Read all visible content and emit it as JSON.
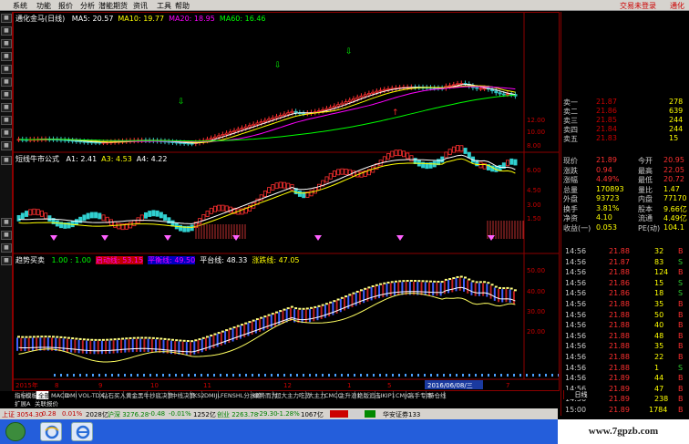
{
  "menu": {
    "items": [
      "系统",
      "功能",
      "报价",
      "分析",
      "潜能期货",
      "资讯",
      "工具",
      "帮助"
    ],
    "right": [
      "交易未登录",
      "通化"
    ]
  },
  "left_icons": [
    "grid-icon",
    "chart-icon",
    "list-icon",
    "bar-icon",
    "trend-icon",
    "kline-icon",
    "candle-icon",
    "zoom-icon",
    "tick-icon",
    "flag-icon",
    "square-icon",
    "globe-icon",
    "rsi-icon",
    "candle2-icon",
    "fx-icon",
    "a-icon"
  ],
  "panel1": {
    "name": "通化金马(日线)",
    "ma": [
      {
        "label": "MA5: 20.57",
        "color": "#ffffff"
      },
      {
        "label": "MA10: 19.77",
        "color": "#ffff00"
      },
      {
        "label": "MA20: 18.95",
        "color": "#ff00ff"
      },
      {
        "label": "MA60: 16.46",
        "color": "#00ff00"
      }
    ],
    "axis": [
      "12.00",
      "10.00",
      "8.00"
    ]
  },
  "panel2": {
    "name": "短线牛市公式",
    "values": [
      {
        "label": "A1: 2.41",
        "color": "#ffffff"
      },
      {
        "label": "A3: 4.53",
        "color": "#ffff00"
      },
      {
        "label": "A4: 4.22",
        "color": "#ffffff"
      }
    ],
    "axis": [
      "6.00",
      "4.50",
      "3.00",
      "1.50"
    ]
  },
  "panel3": {
    "name": "趋势买卖",
    "values": [
      {
        "label": "1.00 : 1.00",
        "color": "#00ff00"
      },
      {
        "label": "启动线: 53.15",
        "color": "#ff00ff",
        "bg": "#c00000"
      },
      {
        "label": "平衡线: 49.50",
        "color": "#ff00ff",
        "bg": "#0000c0"
      },
      {
        "label": "平台线: 48.33",
        "color": "#ffffff"
      },
      {
        "label": "涨跌线: 47.05",
        "color": "#ffff00"
      }
    ],
    "axis": [
      "50.00",
      "40.00",
      "30.00",
      "20.00"
    ]
  },
  "dates": [
    "2015年",
    "8",
    "9",
    "10",
    "11",
    "12",
    "1",
    "5",
    "2016/06/08/三",
    "7"
  ],
  "tabs": {
    "row1": [
      "指标",
      "模板",
      "全部",
      "MACD",
      "DMI",
      "VOL-TDX",
      "钻石买入",
      "黄金黑牛",
      "抄底决策",
      "中线决策",
      "KS2",
      "DMIJL",
      "FENSHL分水岭",
      "顺势而为",
      "超大主力吃货",
      "大主力",
      "CMCC",
      "主升浪1",
      "绝版追击",
      "LIKIP1",
      "CMJC",
      "高手专用",
      "持仓线"
    ],
    "row2": [
      "扩展A",
      "关联报价"
    ],
    "right_label": "日线"
  },
  "quote": {
    "orderbook": [
      {
        "label": "卖一",
        "price": "21.87",
        "vol": "278"
      },
      {
        "label": "卖二",
        "price": "21.86",
        "vol": "639"
      },
      {
        "label": "卖三",
        "price": "21.85",
        "vol": "244"
      },
      {
        "label": "卖四",
        "price": "21.84",
        "vol": "244"
      },
      {
        "label": "卖五",
        "price": "21.83",
        "vol": "15"
      }
    ],
    "axis_right": [
      "12.00",
      "10.00",
      "8.00"
    ],
    "stats": [
      {
        "l1": "现价",
        "v1": "21.89",
        "l2": "今开",
        "v2": "20.95"
      },
      {
        "l1": "涨跌",
        "v1": "0.94",
        "l2": "最高",
        "v2": "22.05"
      },
      {
        "l1": "涨幅",
        "v1": "4.49%",
        "l2": "最低",
        "v2": "20.72"
      },
      {
        "l1": "总量",
        "v1": "170893",
        "l2": "量比",
        "v2": "1.47"
      },
      {
        "l1": "外盘",
        "v1": "93723",
        "l2": "内盘",
        "v2": "77170"
      },
      {
        "l1": "换手",
        "v1": "3.81%",
        "l2": "股本",
        "v2": "9.66亿"
      },
      {
        "l1": "净资",
        "v1": "4.10",
        "l2": "流通",
        "v2": "4.49亿"
      },
      {
        "l1": "收益(一)",
        "v1": "0.053",
        "l2": "PE(动)",
        "v2": "104.1"
      }
    ],
    "ticks": [
      {
        "t": "14:56",
        "p": "21.88",
        "v": "32",
        "d": "B"
      },
      {
        "t": "14:56",
        "p": "21.87",
        "v": "83",
        "d": "S"
      },
      {
        "t": "14:56",
        "p": "21.88",
        "v": "124",
        "d": "B"
      },
      {
        "t": "14:56",
        "p": "21.86",
        "v": "15",
        "d": "S"
      },
      {
        "t": "14:56",
        "p": "21.86",
        "v": "18",
        "d": "S"
      },
      {
        "t": "14:56",
        "p": "21.88",
        "v": "35",
        "d": "B"
      },
      {
        "t": "14:56",
        "p": "21.88",
        "v": "50",
        "d": "B"
      },
      {
        "t": "14:56",
        "p": "21.88",
        "v": "40",
        "d": "B"
      },
      {
        "t": "14:56",
        "p": "21.88",
        "v": "48",
        "d": "B"
      },
      {
        "t": "14:56",
        "p": "21.88",
        "v": "35",
        "d": "B"
      },
      {
        "t": "14:56",
        "p": "21.88",
        "v": "22",
        "d": "B"
      },
      {
        "t": "14:56",
        "p": "21.88",
        "v": "1",
        "d": "S"
      },
      {
        "t": "14:56",
        "p": "21.89",
        "v": "44",
        "d": "B"
      },
      {
        "t": "14:56",
        "p": "21.89",
        "v": "47",
        "d": "B"
      },
      {
        "t": "14:56",
        "p": "21.89",
        "v": "238",
        "d": "B"
      },
      {
        "t": "15:00",
        "p": "21.89",
        "v": "1784",
        "d": "B"
      }
    ]
  },
  "status": {
    "items": [
      {
        "text": "上证 3054.30",
        "color": "#c00000"
      },
      {
        "text": "0.28",
        "color": "#c00000"
      },
      {
        "text": "0.01%",
        "color": "#c00000"
      },
      {
        "text": "2028亿",
        "color": "#000000"
      },
      {
        "text": "沪深 3276.28",
        "color": "#008000"
      },
      {
        "text": "-0.48",
        "color": "#008000"
      },
      {
        "text": "-0.01%",
        "color": "#008000"
      },
      {
        "text": "1252亿",
        "color": "#000000"
      },
      {
        "text": "创业 2263.78",
        "color": "#008000"
      },
      {
        "text": "-29.30",
        "color": "#008000"
      },
      {
        "text": "-1.28%",
        "color": "#008000"
      },
      {
        "text": "1067亿",
        "color": "#000000"
      },
      {
        "text": "华安证券133",
        "color": "#000000"
      }
    ]
  },
  "watermark": "www.7gpzb.com"
}
